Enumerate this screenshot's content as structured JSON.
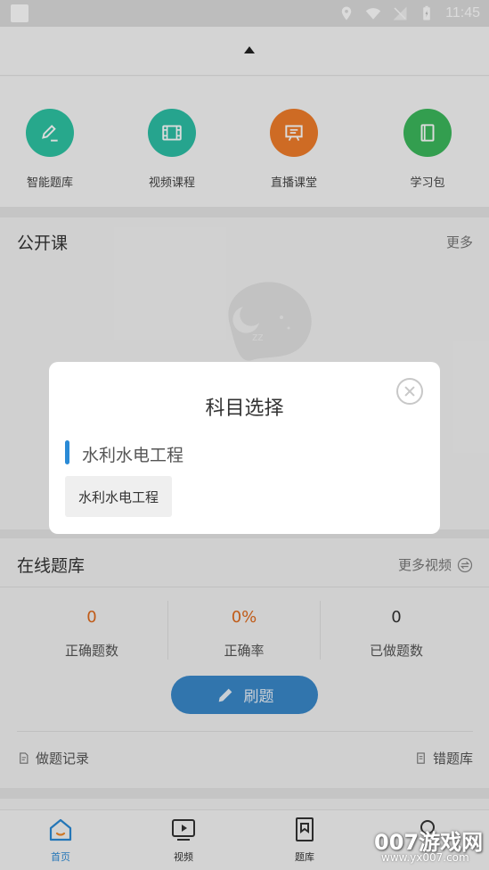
{
  "status_bar": {
    "time": "11:45"
  },
  "quick_nav": [
    {
      "label": "智能题库",
      "icon": "pencil-note-icon",
      "color": "#2ec4a3"
    },
    {
      "label": "视频课程",
      "icon": "film-icon",
      "color": "#2dbfa6"
    },
    {
      "label": "直播课堂",
      "icon": "presentation-board-icon",
      "color": "#f07d2a"
    },
    {
      "label": "学习包",
      "icon": "book-icon",
      "color": "#3cb85c"
    }
  ],
  "open_course": {
    "title": "公开课",
    "more": "更多"
  },
  "online_bank": {
    "title": "在线题库",
    "more": "更多视频",
    "stats": [
      {
        "value": "0",
        "label": "正确题数",
        "color": "#e06a1c"
      },
      {
        "value": "0%",
        "label": "正确率",
        "color": "#e06a1c"
      },
      {
        "value": "0",
        "label": "已做题数",
        "color": "#333333"
      }
    ],
    "button": "刷题",
    "record_link": "做题记录",
    "wrong_link": "错题库"
  },
  "tabs": [
    {
      "label": "首页",
      "active": true
    },
    {
      "label": "视频",
      "active": false
    },
    {
      "label": "题库",
      "active": false
    }
  ],
  "modal": {
    "title": "科目选择",
    "group": "水利水电工程",
    "option": "水利水电工程"
  },
  "watermark": {
    "main": "007游戏网",
    "sub": "www.yx007.com"
  }
}
